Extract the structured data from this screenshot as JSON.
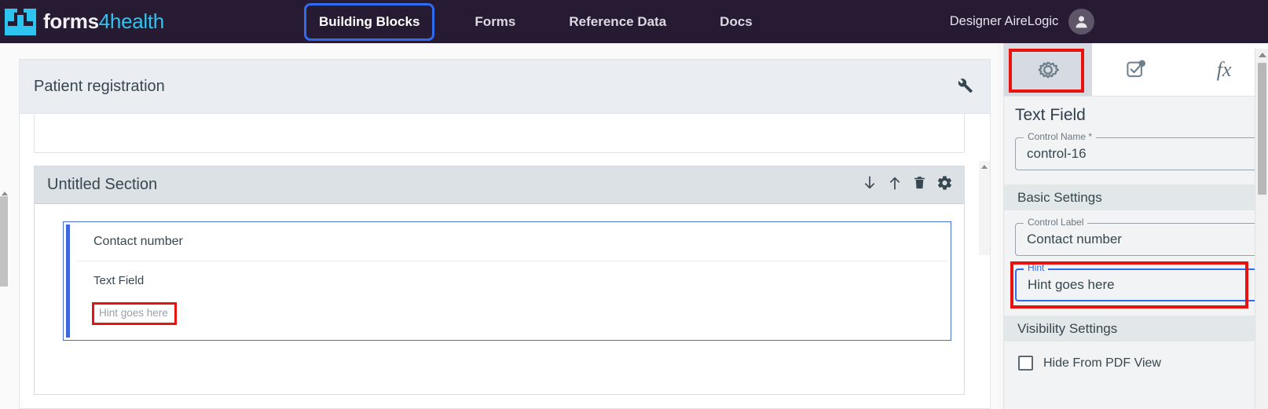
{
  "topnav": {
    "brand": {
      "part1": "forms",
      "part2": "4health",
      "logo_icon": "forms4health-logo-icon"
    },
    "items": [
      {
        "label": "Building Blocks",
        "active": true
      },
      {
        "label": "Forms",
        "active": false
      },
      {
        "label": "Reference Data",
        "active": false
      },
      {
        "label": "Docs",
        "active": false
      }
    ],
    "user": {
      "name": "Designer AireLogic",
      "avatar_icon": "person-icon"
    },
    "colors": {
      "background": "#271a33",
      "accent": "#2ec4f0",
      "focus_outline": "#2f6bee"
    }
  },
  "canvas": {
    "form_title": "Patient registration",
    "form_tools_icon": "wrench-icon",
    "section": {
      "title": "Untitled Section",
      "icons": [
        {
          "name": "move-down-icon",
          "glyph": "arrow-down"
        },
        {
          "name": "move-up-icon",
          "glyph": "arrow-up"
        },
        {
          "name": "delete-icon",
          "glyph": "trash"
        },
        {
          "name": "settings-icon",
          "glyph": "gear"
        }
      ],
      "control": {
        "label": "Contact number",
        "type": "Text Field",
        "hint": "Hint goes here",
        "selected_border_color": "#4a6fd4",
        "annotation_color": "#e8120f"
      }
    }
  },
  "right_panel": {
    "tabs": [
      {
        "name": "settings-tab",
        "icon": "gear-icon",
        "selected": true,
        "annotated": true
      },
      {
        "name": "validation-tab",
        "icon": "checkbox-badge-icon",
        "selected": false,
        "annotated": false
      },
      {
        "name": "expression-tab",
        "icon": "fx-icon",
        "label": "fx",
        "selected": false,
        "annotated": false
      }
    ],
    "heading": "Text Field",
    "fields": [
      {
        "legend": "Control Name *",
        "value": "control-16",
        "focused": false,
        "annotated": false
      },
      {
        "legend": "Control Label",
        "value": "Contact number",
        "focused": false,
        "annotated": false
      },
      {
        "legend": "Hint",
        "value": "Hint goes here",
        "focused": true,
        "annotated": true
      }
    ],
    "sections": [
      {
        "label": "Basic Settings"
      },
      {
        "label": "Visibility Settings"
      }
    ],
    "checkbox": {
      "label": "Hide From PDF View",
      "checked": false
    }
  }
}
